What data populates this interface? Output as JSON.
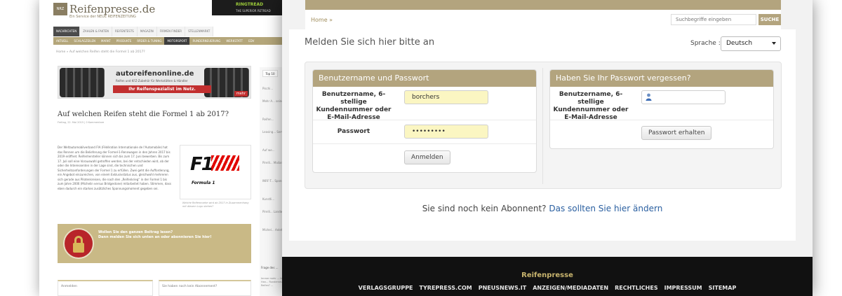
{
  "background_page": {
    "logo_text": "Reifenpresse.de",
    "tagline": "Ein Service der NEUE REIFENZEITUNG",
    "banner_text": "RINGTREAD",
    "banner_sub": "THE SUPERIOR RETREAD",
    "nav_primary": [
      "NACHRICHTEN",
      "ZAHLEN & FAKTEN",
      "REIFENTESTS",
      "MAGAZIN",
      "FIRMEN FINDER",
      "STELLENMARKT"
    ],
    "nav_secondary": [
      "AKTUELL",
      "SCHLAGZEILEN",
      "MARKT",
      "PRODUKTE",
      "RÄDER & TUNING",
      "MOTORSPORT",
      "RUNDERNEUERUNG",
      "WERKSTATT",
      "EDV"
    ],
    "breadcrumb": "Home » Auf welchen Reifen steht die Formel 1 ab 2017?",
    "ad_title": "autoreifenonline.de",
    "ad_sub": "Reifen und KFZ-Zubehör für Werkstätten & Händler",
    "ad_slogan": "Ihr Reifenspezialist im Netz.",
    "ad_more": "mehr",
    "article_title": "Auf welchen Reifen steht die Formel 1 ab 2017?",
    "article_meta": "Freitag, 22. Mai 2015 | 0 Kommentare",
    "article_text": "Der Weltautomobilverband FIA (Fédération Internationale de l'Automobile) hat das Rennen um die Belieferung der Formel-1-Rennwagen in den Jahren 2017 bis 2019 eröffnet. Reifenhersteller können sich bis zum 17. Juni bewerben. Bis zum 17. Juli soll eine Vorauswahl getroffen werden, bei der entschieden wird, ob der oder die Interessenten in der Lage sind, die technischen und Sicherheitsanforderungen der Formel 1 zu erfüllen. Zwei geht die Aufforderung, ein Angebot einzureichen, von einem Exklusivstatus aus, gleichwohl mehreren sich gerade aus Pilotenkreisen, die nach den „Reifenkrieg“ in der Formel 1 bis zum Jahre 2006 (Michelin versus Bridgestone) mitarbeitet haben. Stimmen, dass eben dadurch ein starkes zusätzliches Spannungsmoment gegeben sei.",
    "f1_logo_text": "F1",
    "f1_logo_name": "Formula 1",
    "image_caption": "Welche Reifenmarke wird ab 2017 in Zusammenhang mit diesem Logo stehen?",
    "paywall_line1": "Wollen Sie den ganzen Beitrag lesen?",
    "paywall_line2": "Dann melden Sie sich unten an oder abonnieren Sie hier!",
    "login_left_label": "Anmelden",
    "login_right_label": "Sie haben noch kein Abonnement?",
    "sidebar_tab": "Top 10",
    "sidebar_items": [
      "Pischi...",
      "Mehr A... seine S...",
      "Reifen...",
      "Leasing... Service...",
      "Auf we...",
      "Pirelli... Mailan...",
      "INRF-T... Sponso...",
      "Kunstli...",
      "Pirelli... Landw...",
      "Michel... Anleh..."
    ],
    "sidebar_question": "Frage des ...",
    "sidebar_question_text": "Immer mehr ... hiesigen Han... Runderneuer... Reifen? ..."
  },
  "foreground": {
    "breadcrumb_home": "Home »",
    "search_placeholder": "Suchbegriffe eingeben",
    "search_button": "SUCHE",
    "heading": "Melden Sie sich hier bitte an",
    "language_label": "Sprache :",
    "language_value": "Deutsch",
    "login_panel": {
      "title": "Benutzername und Passwort",
      "username_label": "Benutzername, 6-stellige Kundennummer oder E-Mail-Adresse",
      "username_value": "borchers",
      "password_label": "Passwort",
      "password_value": "•••••••••",
      "submit_label": "Anmelden"
    },
    "forgot_panel": {
      "title": "Haben Sie Ihr Passwort vergessen?",
      "username_label": "Benutzername, 6-stellige Kundennummer oder E-Mail-Adresse",
      "username_value": "",
      "submit_label": "Passwort erhalten"
    },
    "notice_text": "Sie sind noch kein Abonnent?",
    "notice_link": "Das sollten Sie hier ändern",
    "footer_title": "Reifenpresse",
    "footer_links": [
      "VERLAGSGRUPPE",
      "TYREPRESS.COM",
      "PNEUSNEWS.IT",
      "ANZEIGEN/MEDIADATEN",
      "RECHTLICHES",
      "IMPRESSUM",
      "SITEMAP"
    ]
  },
  "colors": {
    "brand_gold": "#b3a47e",
    "input_autofill": "#fbf6c2",
    "link_blue": "#2a5fa0",
    "footer_bg": "#111111",
    "footer_title": "#c9b56e"
  }
}
